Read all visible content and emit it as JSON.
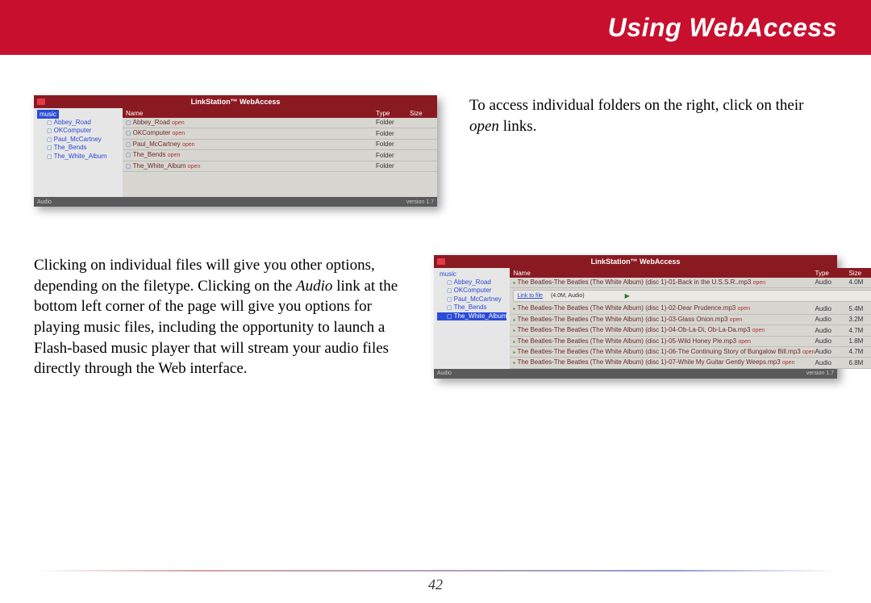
{
  "header": {
    "title": "Using WebAccess"
  },
  "para1_before": "To access individual folders on the right, click on their ",
  "para1_em": "open",
  "para1_after": " links.",
  "para2_before": "Clicking on individual files will give you other options, depending on the filetype.  Clicking on the ",
  "para2_em": "Audio",
  "para2_after": " link at the bottom left corner of the page will give you options for playing music files, including the opportunity to launch a Flash-based music player that will stream your audio files directly through the Web interface.",
  "page_number": "42",
  "shot1": {
    "title": "LinkStation™  WebAccess",
    "tree_root": "music",
    "tree": [
      "Abbey_Road",
      "OKComputer",
      "Paul_McCartney",
      "The_Bends",
      "The_White_Album"
    ],
    "cols": {
      "name": "Name",
      "type": "Type",
      "size": "Size"
    },
    "rows": [
      {
        "name": "Abbey_Road",
        "link": "open",
        "type": "Folder",
        "size": ""
      },
      {
        "name": "OKComputer",
        "link": "open",
        "type": "Folder",
        "size": ""
      },
      {
        "name": "Paul_McCartney",
        "link": "open",
        "type": "Folder",
        "size": ""
      },
      {
        "name": "The_Bends",
        "link": "open",
        "type": "Folder",
        "size": ""
      },
      {
        "name": "The_White_Album",
        "link": "open",
        "type": "Folder",
        "size": ""
      }
    ],
    "footer_left": "Audio",
    "footer_right": "version 1.7"
  },
  "shot2": {
    "title": "LinkStation™  WebAccess",
    "tree_root": "music",
    "tree": [
      "Abbey_Road",
      "OKComputer",
      "Paul_McCartney",
      "The_Bends",
      "The_White_Album"
    ],
    "tree_selected": 4,
    "cols": {
      "name": "Name",
      "type": "Type",
      "size": "Size"
    },
    "detail": {
      "label": "Link to file",
      "size": "(4.0M, Audio)"
    },
    "rows": [
      {
        "name": "The Beatles-The Beatles (The White Album) (disc 1)-01-Back in the U.S.S.R..mp3",
        "link": "open",
        "type": "Audio",
        "size": "4.0M"
      },
      {
        "name": "The Beatles-The Beatles (The White Album) (disc 1)-02-Dear Prudence.mp3",
        "link": "open",
        "type": "Audio",
        "size": "5.4M"
      },
      {
        "name": "The Beatles-The Beatles (The White Album) (disc 1)-03-Glass Onion.mp3",
        "link": "open",
        "type": "Audio",
        "size": "3.2M"
      },
      {
        "name": "The Beatles-The Beatles (The White Album) (disc 1)-04-Ob-La-Di, Ob-La-Da.mp3",
        "link": "open",
        "type": "Audio",
        "size": "4.7M"
      },
      {
        "name": "The Beatles-The Beatles (The White Album) (disc 1)-05-Wild Honey Pie.mp3",
        "link": "open",
        "type": "Audio",
        "size": "1.8M"
      },
      {
        "name": "The Beatles-The Beatles (The White Album) (disc 1)-06-The Continuing Story of Bungalow Bill.mp3",
        "link": "open",
        "type": "Audio",
        "size": "4.7M"
      },
      {
        "name": "The Beatles-The Beatles (The White Album) (disc 1)-07-While My Guitar Gently Weeps.mp3",
        "link": "open",
        "type": "Audio",
        "size": "6.8M"
      }
    ],
    "footer_left": "Audio",
    "footer_right": "version 1.7"
  }
}
